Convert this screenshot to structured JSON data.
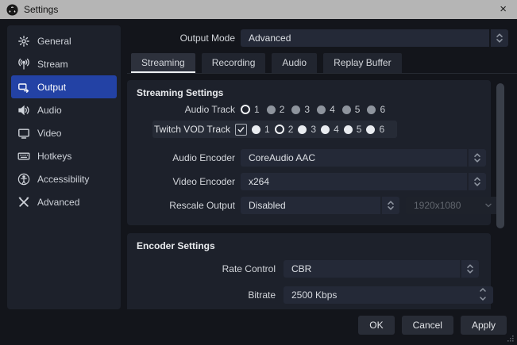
{
  "window": {
    "title": "Settings",
    "close_glyph": "×"
  },
  "sidebar": {
    "selected_item": "Output",
    "items": [
      {
        "label": "General",
        "icon": "gear-icon"
      },
      {
        "label": "Stream",
        "icon": "broadcast-icon"
      },
      {
        "label": "Output",
        "icon": "output-icon"
      },
      {
        "label": "Audio",
        "icon": "speaker-icon"
      },
      {
        "label": "Video",
        "icon": "monitor-icon"
      },
      {
        "label": "Hotkeys",
        "icon": "keyboard-icon"
      },
      {
        "label": "Accessibility",
        "icon": "accessibility-icon"
      },
      {
        "label": "Advanced",
        "icon": "tools-icon"
      }
    ]
  },
  "output_mode": {
    "label": "Output Mode",
    "value": "Advanced"
  },
  "tabs": [
    {
      "label": "Streaming",
      "selected": true
    },
    {
      "label": "Recording",
      "selected": false
    },
    {
      "label": "Audio",
      "selected": false
    },
    {
      "label": "Replay Buffer",
      "selected": false
    }
  ],
  "streaming_settings": {
    "title": "Streaming Settings",
    "audio_track": {
      "label": "Audio Track",
      "options": [
        "1",
        "2",
        "3",
        "4",
        "5",
        "6"
      ],
      "selected": "1"
    },
    "twitch_vod_track": {
      "label": "Twitch VOD Track",
      "checkbox_checked": true,
      "options": [
        "1",
        "2",
        "3",
        "4",
        "5",
        "6"
      ],
      "selected": "2"
    },
    "audio_encoder": {
      "label": "Audio Encoder",
      "value": "CoreAudio AAC"
    },
    "video_encoder": {
      "label": "Video Encoder",
      "value": "x264"
    },
    "rescale_output": {
      "label": "Rescale Output",
      "value": "Disabled",
      "resolution_value": "1920x1080",
      "resolution_enabled": false
    }
  },
  "encoder_settings": {
    "title": "Encoder Settings",
    "rate_control": {
      "label": "Rate Control",
      "value": "CBR"
    },
    "bitrate": {
      "label": "Bitrate",
      "value": "2500 Kbps"
    }
  },
  "footer": {
    "ok_label": "OK",
    "cancel_label": "Cancel",
    "apply_label": "Apply"
  },
  "colors": {
    "accent_blue": "#2342a5",
    "titlebar_bg": "#b5b5b5",
    "window_bg": "#13151b",
    "panel_bg": "#1d212b",
    "highlight_row": "#262b36",
    "selected_tab_underline": "#eceef0"
  }
}
